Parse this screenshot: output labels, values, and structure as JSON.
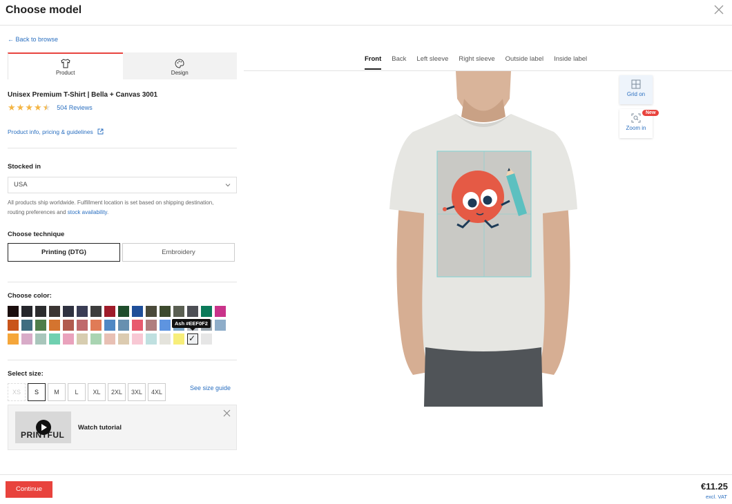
{
  "header": {
    "title": "Choose model"
  },
  "back_link": "← Back to browse",
  "left_tabs": [
    {
      "label": "Product",
      "icon": "tshirt-icon"
    },
    {
      "label": "Design",
      "icon": "palette-icon"
    }
  ],
  "product": {
    "title": "Unisex Premium T-Shirt | Bella + Canvas 3001",
    "rating": 4.5,
    "reviews": "504 Reviews",
    "info_link": "Product info, pricing & guidelines"
  },
  "stocked": {
    "label": "Stocked in",
    "value": "USA",
    "note_pre": "All products ship worldwide. Fulfillment location is set based on shipping destination, routing preferences and ",
    "note_link": "stock availability",
    "note_post": "."
  },
  "technique": {
    "label": "Choose technique",
    "options": [
      "Printing (DTG)",
      "Embroidery"
    ],
    "selected": "Printing (DTG)"
  },
  "color": {
    "label": "Choose color:",
    "tooltip": "Ash #EEF0F2",
    "rows": [
      [
        "#1a0d0d",
        "#25262b",
        "#2c2c2e",
        "#3b3533",
        "#2f3240",
        "#3a3d55",
        "#3d3d3d",
        "#9f1c2a",
        "#1f4d2c",
        "#1f4f99",
        "#4a4a3a",
        "#3d4a2d",
        "#5a5f52",
        "#4d4f55",
        "#0b7a5a",
        "#c9338a"
      ],
      [
        "#c9541a",
        "#3f6d80",
        "#4e7d4a",
        "#d4742f",
        "#b15b4e",
        "#bf6a6c",
        "#e07b57",
        "#4f88c4",
        "#6790b0",
        "#e85a6e",
        "#b07e7e",
        "#5e94e0",
        "#7da7c7",
        "#b4bcc4",
        "#9aa6b0",
        "#8eadc9"
      ],
      [
        "#f5a63a",
        "#d8abc8",
        "#a8c6bb",
        "#6fd0b0",
        "#e9a2bc",
        "#d7cdb0",
        "#a9d4b2",
        "#e8c0b4",
        "#dccbb0",
        "#f8c8d4",
        "#bfe0e0",
        "#e4e3dc",
        "#f7ee7a",
        "#eef0f2",
        "#e6e6e6"
      ]
    ],
    "selected": "#eef0f2"
  },
  "size": {
    "label": "Select size:",
    "options": [
      "XS",
      "S",
      "M",
      "L",
      "XL",
      "2XL",
      "3XL",
      "4XL"
    ],
    "selected": "S",
    "disabled": [
      "XS"
    ],
    "guide": "See size guide"
  },
  "tutorial": {
    "label": "Watch tutorial",
    "brand": "PRINTFUL"
  },
  "view_tabs": [
    "Front",
    "Back",
    "Left sleeve",
    "Right sleeve",
    "Outside label",
    "Inside label"
  ],
  "view_active": "Front",
  "tools": {
    "grid": "Grid on",
    "zoom": "Zoom in",
    "badge": "New"
  },
  "footer": {
    "continue": "Continue",
    "price": "€11.25",
    "vat": "excl. VAT"
  },
  "colors": {
    "accent": "#e8433d",
    "link": "#2a6fc0",
    "shirt": "#e6e6e2"
  }
}
